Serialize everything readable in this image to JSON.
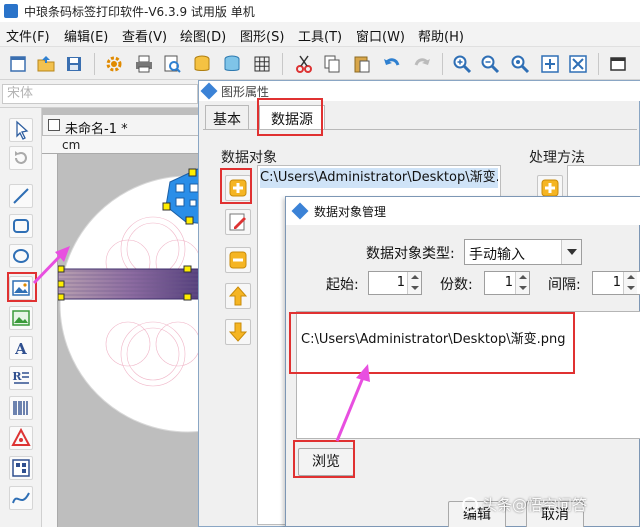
{
  "window": {
    "title": "中琅条码标签打印软件-V6.3.9 试用版 单机"
  },
  "menubar": {
    "items": [
      "文件(F)",
      "编辑(E)",
      "查看(V)",
      "绘图(D)",
      "图形(S)",
      "工具(T)",
      "窗口(W)",
      "帮助(H)"
    ]
  },
  "toolbar": {
    "icons": [
      "new-icon",
      "open-icon",
      "save-icon",
      "settings-icon",
      "print-icon",
      "print-preview-icon",
      "database-icon",
      "database-connect-icon",
      "grid-icon",
      "cut-icon",
      "copy-icon",
      "paste-icon",
      "undo-icon",
      "redo-icon",
      "zoom-in-icon",
      "zoom-out-icon",
      "zoom-fit-icon",
      "fit-page-icon",
      "actual-size-icon",
      "window-icon"
    ]
  },
  "font_bar": {
    "font_name": "宋体"
  },
  "left_tools": {
    "icons": [
      "pointer-icon",
      "rotate-icon",
      "line-icon",
      "rectangle-icon",
      "ellipse-icon",
      "image-icon",
      "picture-icon",
      "text-icon",
      "rich-text-icon",
      "barcode-icon",
      "qrcode-icon",
      "shape-icon",
      "curve-icon"
    ],
    "active": "image-icon"
  },
  "document": {
    "tab_title": "未命名-1 *",
    "ruler_unit": "cm"
  },
  "graphic_props_dialog": {
    "title": "图形属性",
    "tabs": [
      "基本",
      "数据源"
    ],
    "active_tab": "数据源",
    "data_object_label": "数据对象",
    "processing_label": "处理方法",
    "data_object_item": "C:\\Users\\Administrator\\Desktop\\渐变.p",
    "side_buttons": [
      "add-icon",
      "edit-icon",
      "remove-icon",
      "move-up-icon",
      "move-down-icon"
    ]
  },
  "data_object_dialog": {
    "title": "数据对象管理",
    "type_label": "数据对象类型:",
    "type_value": "手动输入",
    "start_label": "起始:",
    "start_value": "1",
    "copies_label": "份数:",
    "copies_value": "1",
    "interval_label": "间隔:",
    "interval_value": "1",
    "path_value": "C:\\Users\\Administrator\\Desktop\\渐变.png",
    "browse_button": "浏览",
    "edit_button": "编辑",
    "cancel_button": "取消"
  },
  "watermark": {
    "text": "头条@悟空问答"
  },
  "colors": {
    "highlight": "#e03131",
    "arrow": "#e84fe0",
    "selection_handle": "#ffee00"
  }
}
